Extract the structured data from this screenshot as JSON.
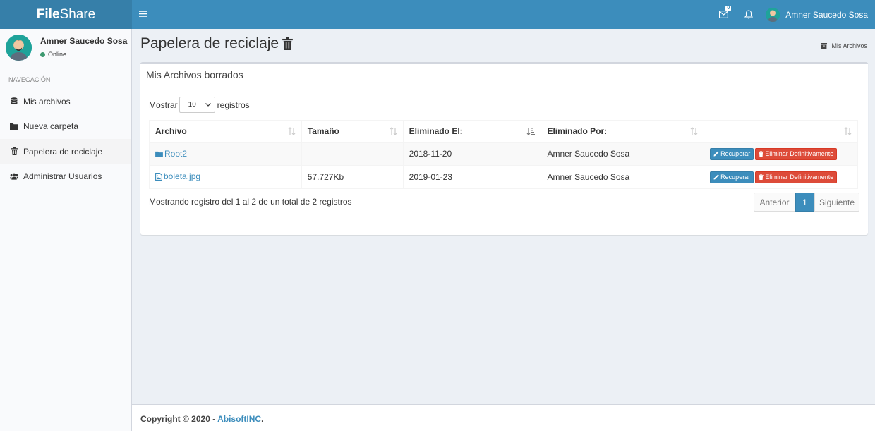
{
  "app": {
    "logo_bold": "File",
    "logo_rest": "Share"
  },
  "navbar": {
    "mail_badge": "0",
    "user_name": "Amner Saucedo Sosa"
  },
  "sidebar": {
    "user_name": "Amner Saucedo Sosa",
    "status": "Online",
    "nav_header": "NAVEGACIÓN",
    "items": [
      {
        "label": "Mis archivos",
        "icon": "database-icon"
      },
      {
        "label": "Nueva carpeta",
        "icon": "folder-icon"
      },
      {
        "label": "Papelera de reciclaje",
        "icon": "trash-icon"
      },
      {
        "label": "Administrar Usuarios",
        "icon": "users-icon"
      }
    ],
    "active_index": 2
  },
  "page": {
    "title": "Papelera de reciclaje",
    "breadcrumb": "Mis Archivos"
  },
  "box": {
    "title": "Mis Archivos borrados",
    "length_prefix": "Mostrar",
    "length_value": "10",
    "length_suffix": "registros",
    "columns": [
      "Archivo",
      "Tamaño",
      "Eliminado El:",
      "Eliminado Por:",
      ""
    ],
    "rows": [
      {
        "name": "Root2",
        "type": "folder",
        "size": "",
        "deleted_on": "2018-11-20",
        "deleted_by": "Amner Saucedo Sosa"
      },
      {
        "name": "boleta.jpg",
        "type": "image",
        "size": "57.727Kb",
        "deleted_on": "2019-01-23",
        "deleted_by": "Amner Saucedo Sosa"
      }
    ],
    "recover_label": "Recuperar",
    "delete_label": "Eliminar Definitivamente",
    "info": "Mostrando registro del 1 al 2 de un total de 2 registros",
    "pager": {
      "prev": "Anterior",
      "current": "1",
      "next": "Siguiente"
    }
  },
  "footer": {
    "prefix": "Copyright © 2020 - ",
    "company": "AbisoftINC",
    "suffix": "."
  },
  "colors": {
    "navbar": "#3c8dbc",
    "logo": "#367fa9",
    "danger": "#dd4b39"
  }
}
